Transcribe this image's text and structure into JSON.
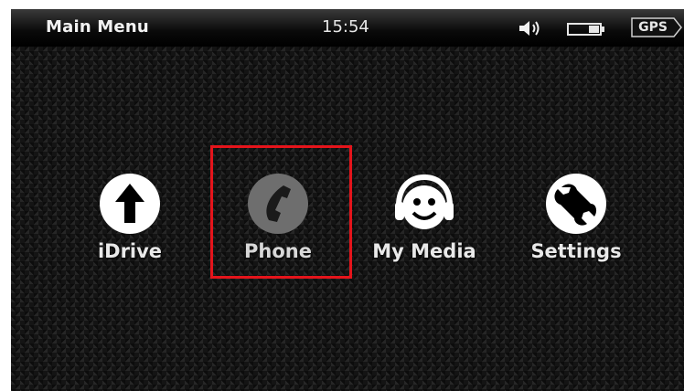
{
  "header": {
    "title": "Main Menu",
    "time": "15:54",
    "gps_label": "GPS",
    "icons": {
      "volume": "speaker-icon",
      "battery": "battery-icon"
    }
  },
  "menu": {
    "items": [
      {
        "label": "iDrive",
        "icon": "up-arrow-icon"
      },
      {
        "label": "Phone",
        "icon": "phone-icon",
        "selected": true
      },
      {
        "label": "My Media",
        "icon": "headphones-smiley-icon"
      },
      {
        "label": "Settings",
        "icon": "wrench-icon"
      }
    ]
  },
  "colors": {
    "selection": "#e5141b",
    "icon_bg": "#ffffff",
    "selected_icon_bg": "#6e6e6e",
    "label": "#e9e9e9"
  }
}
